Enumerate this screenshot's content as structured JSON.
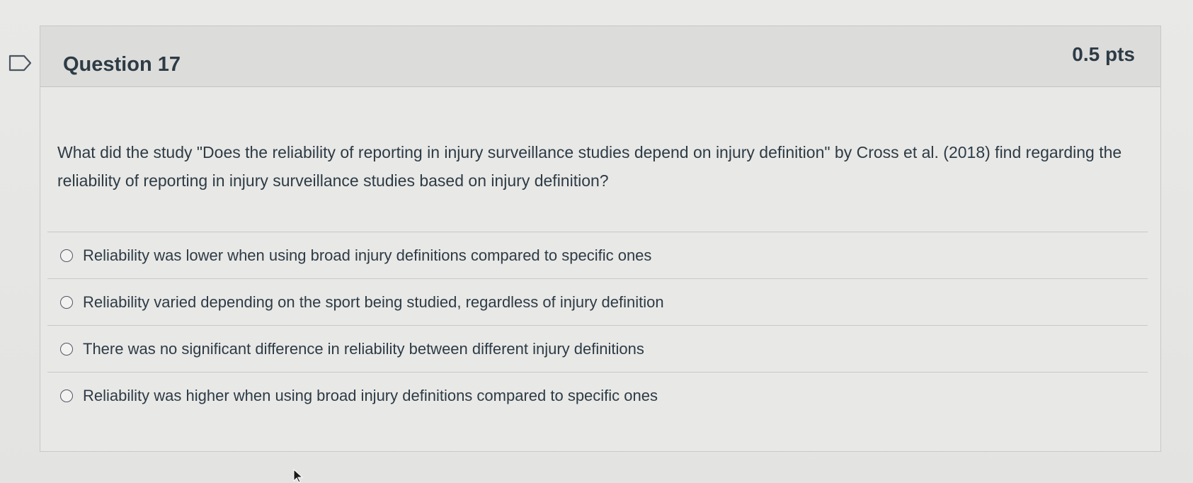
{
  "question": {
    "title": "Question 17",
    "points": "0.5 pts",
    "text": "What did the study \"Does the reliability of reporting in injury surveillance studies depend on injury definition\" by Cross et al. (2018) find regarding the reliability of reporting in injury surveillance studies based on injury definition?"
  },
  "answers": [
    {
      "label": "Reliability was lower when using broad injury definitions compared to specific ones",
      "selected": false
    },
    {
      "label": "Reliability varied depending on the sport being studied, regardless of injury definition",
      "selected": false
    },
    {
      "label": "There was no significant difference in reliability between different injury definitions",
      "selected": false
    },
    {
      "label": "Reliability was higher when using broad injury definitions compared to specific ones",
      "selected": false
    }
  ],
  "icons": {
    "flag": "flag-question-icon",
    "cursor": "mouse-pointer-icon"
  }
}
